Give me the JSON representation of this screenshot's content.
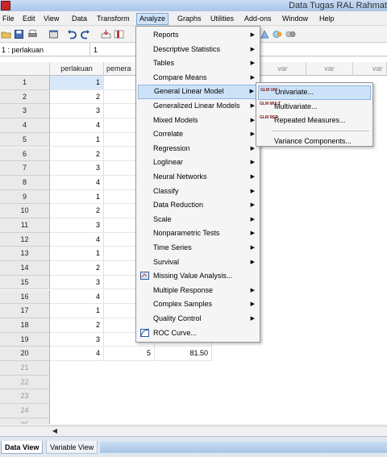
{
  "window": {
    "title": "Data Tugas RAL Rahmat"
  },
  "menubar": [
    "File",
    "Edit",
    "View",
    "Data",
    "Transform",
    "Analyze",
    "Graphs",
    "Utilities",
    "Add-ons",
    "Window",
    "Help"
  ],
  "cellref": {
    "name": "1 : perlakuan",
    "value": "1"
  },
  "grid": {
    "columns": [
      "perlakuan",
      "pemera",
      "var",
      "var",
      "var"
    ],
    "rows": [
      {
        "n": "1",
        "perlakuan": "1"
      },
      {
        "n": "2",
        "perlakuan": "2"
      },
      {
        "n": "3",
        "perlakuan": "3"
      },
      {
        "n": "4",
        "perlakuan": "4"
      },
      {
        "n": "5",
        "perlakuan": "1"
      },
      {
        "n": "6",
        "perlakuan": "2"
      },
      {
        "n": "7",
        "perlakuan": "3"
      },
      {
        "n": "8",
        "perlakuan": "4"
      },
      {
        "n": "9",
        "perlakuan": "1"
      },
      {
        "n": "10",
        "perlakuan": "2"
      },
      {
        "n": "11",
        "perlakuan": "3"
      },
      {
        "n": "12",
        "perlakuan": "4"
      },
      {
        "n": "13",
        "perlakuan": "1"
      },
      {
        "n": "14",
        "perlakuan": "2"
      },
      {
        "n": "15",
        "perlakuan": "3"
      },
      {
        "n": "16",
        "perlakuan": "4"
      },
      {
        "n": "17",
        "perlakuan": "1"
      },
      {
        "n": "18",
        "perlakuan": "2"
      },
      {
        "n": "19",
        "perlakuan": "3"
      },
      {
        "n": "20",
        "perlakuan": "4",
        "pemera": "5",
        "extra": "81.50"
      }
    ],
    "empty_rows": [
      "21",
      "22",
      "23",
      "24",
      "25"
    ]
  },
  "analyze_menu": {
    "items": [
      {
        "label": "Reports",
        "arrow": true
      },
      {
        "label": "Descriptive Statistics",
        "arrow": true
      },
      {
        "label": "Tables",
        "arrow": true
      },
      {
        "label": "Compare Means",
        "arrow": true
      },
      {
        "label": "General Linear Model",
        "arrow": true,
        "highlighted": true
      },
      {
        "label": "Generalized Linear Models",
        "arrow": true
      },
      {
        "label": "Mixed Models",
        "arrow": true
      },
      {
        "label": "Correlate",
        "arrow": true
      },
      {
        "label": "Regression",
        "arrow": true
      },
      {
        "label": "Loglinear",
        "arrow": true
      },
      {
        "label": "Neural Networks",
        "arrow": true
      },
      {
        "label": "Classify",
        "arrow": true
      },
      {
        "label": "Data Reduction",
        "arrow": true
      },
      {
        "label": "Scale",
        "arrow": true
      },
      {
        "label": "Nonparametric Tests",
        "arrow": true
      },
      {
        "label": "Time Series",
        "arrow": true
      },
      {
        "label": "Survival",
        "arrow": true
      },
      {
        "label": "Missing Value Analysis...",
        "arrow": false,
        "icon": "missing-value-icon"
      },
      {
        "label": "Multiple Response",
        "arrow": true
      },
      {
        "label": "Complex Samples",
        "arrow": true
      },
      {
        "label": "Quality Control",
        "arrow": true
      },
      {
        "label": "ROC Curve...",
        "arrow": false,
        "icon": "roc-curve-icon"
      }
    ]
  },
  "glm_submenu": {
    "items": [
      {
        "label": "Univariate...",
        "icon_text": "GLM UNI",
        "highlighted": true
      },
      {
        "label": "Multivariate...",
        "icon_text": "GLM MULT"
      },
      {
        "label": "Repeated Measures...",
        "icon_text": "GLM REP"
      },
      {
        "label": "Variance Components..."
      }
    ]
  },
  "tabs": [
    "Data View",
    "Variable View"
  ],
  "colors": {
    "highlight": "#cde2f9",
    "selected_cell": "#d7e8fb",
    "title_bar": "#a9c6ea"
  }
}
